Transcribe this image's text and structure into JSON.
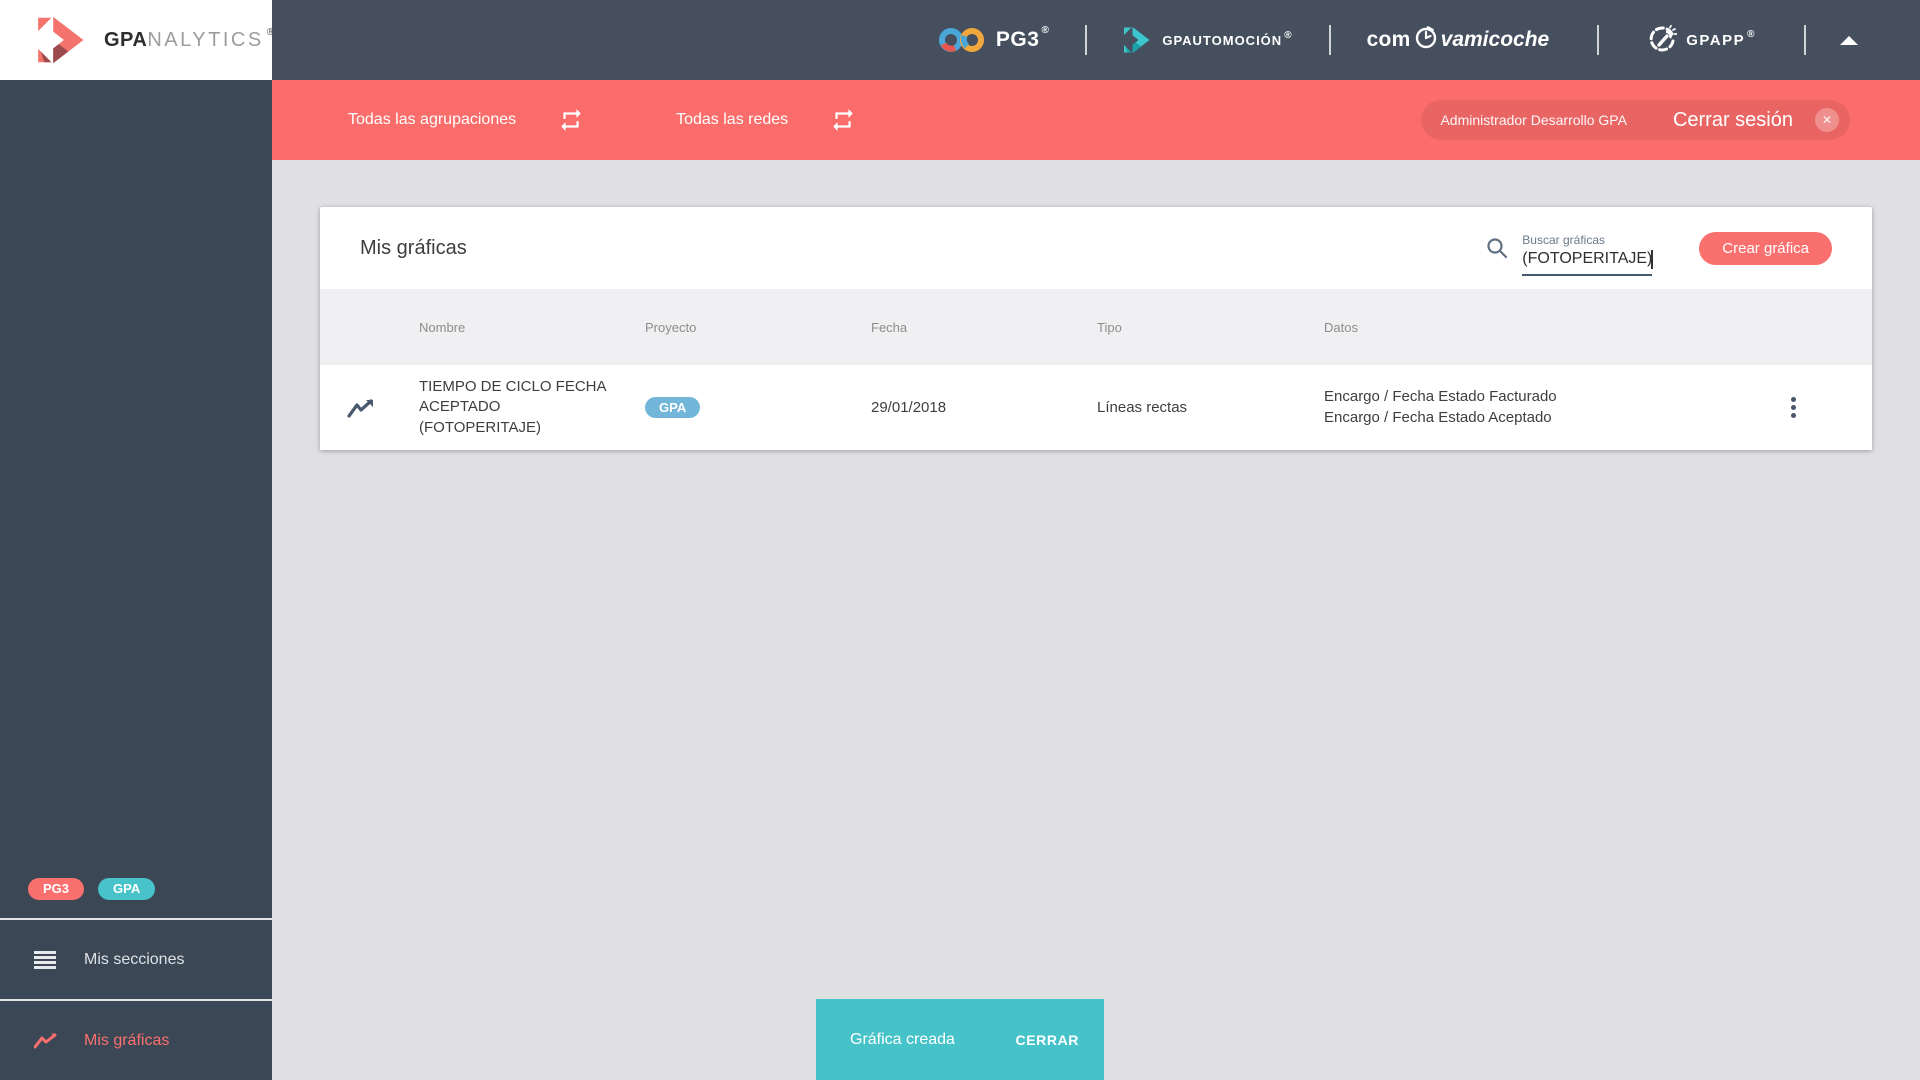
{
  "colors": {
    "accent_red": "#f9706e",
    "teal": "#47c3c9",
    "badge_blue": "#72b7d9",
    "topbar": "#454f5e",
    "sidebar": "#3b4754",
    "redbar": "#fb6d6b"
  },
  "icons": {
    "sidebar_logo": "gpa-arrow",
    "menu": "hamburger",
    "charts": "trending-line",
    "swap": "repeat-arrows",
    "logout_close": "x-circle",
    "search": "magnifier",
    "row_chart": "trending-line",
    "row_menu": "kebab-dots",
    "collapse": "up-triangle",
    "clock": "stopwatch",
    "wrench": "wrench-gauge",
    "infinity": "pg3-infinity",
    "teal_arrow": "gpauto-arrow"
  },
  "sidebar": {
    "logo": {
      "bold": "GPA",
      "light": "NALYTICS",
      "reg": "®"
    },
    "badges": [
      {
        "label": "PG3"
      },
      {
        "label": "GPA"
      }
    ],
    "items": [
      {
        "label": "Mis secciones"
      },
      {
        "label": "Mis gráficas"
      }
    ]
  },
  "topbar": {
    "pg3": {
      "text": "PG3",
      "reg": "®"
    },
    "gpauto": {
      "text": "GPAUTOMOCIÓN",
      "reg": "®"
    },
    "comprova": {
      "pre": "com",
      "post": "vamicoche"
    },
    "gpapp": {
      "text": "GPAPP",
      "reg": "®"
    }
  },
  "filterbar": {
    "groupings_label": "Todas las agrupaciones",
    "networks_label": "Todas las redes",
    "user": "Administrador Desarrollo GPA",
    "logout_label": "Cerrar sesión",
    "close_glyph": "✕"
  },
  "main": {
    "title": "Mis gráficas",
    "search": {
      "label": "Buscar gráficas",
      "value": "(FOTOPERITAJE)"
    },
    "create_button": "Crear gráfica",
    "table": {
      "columns": [
        "Nombre",
        "Proyecto",
        "Fecha",
        "Tipo",
        "Datos"
      ],
      "rows": [
        {
          "name": "TIEMPO DE CICLO FECHA ACEPTADO (FOTOPERITAJE)",
          "project": "GPA",
          "date": "29/01/2018",
          "type": "Líneas rectas",
          "series": [
            "Encargo / Fecha Estado Facturado",
            "Encargo / Fecha Estado Aceptado"
          ]
        }
      ]
    }
  },
  "snackbar": {
    "message": "Gráfica creada",
    "action": "CERRAR"
  }
}
